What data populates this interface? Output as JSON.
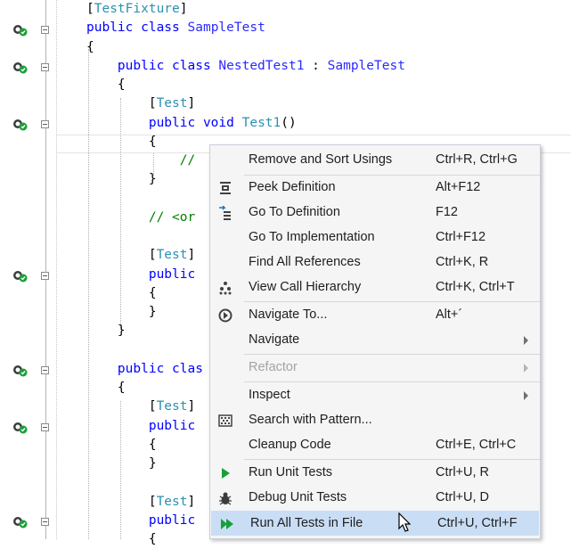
{
  "code_lines": [
    {
      "parts": [
        {
          "t": "[",
          "c": ""
        },
        {
          "t": "TestFixture",
          "c": "attr"
        },
        {
          "t": "]",
          "c": ""
        }
      ]
    },
    {
      "parts": [
        {
          "t": "public class ",
          "c": "kw"
        },
        {
          "t": "SampleTest",
          "c": "cls"
        }
      ]
    },
    {
      "parts": [
        {
          "t": "{",
          "c": ""
        }
      ]
    },
    {
      "parts": [
        {
          "t": "    public class ",
          "c": "kw"
        },
        {
          "t": "NestedTest1",
          "c": "cls"
        },
        {
          "t": " : ",
          "c": ""
        },
        {
          "t": "SampleTest",
          "c": "cls"
        }
      ]
    },
    {
      "parts": [
        {
          "t": "    {",
          "c": ""
        }
      ]
    },
    {
      "parts": [
        {
          "t": "        [",
          "c": ""
        },
        {
          "t": "Test",
          "c": "attr"
        },
        {
          "t": "]",
          "c": ""
        }
      ]
    },
    {
      "parts": [
        {
          "t": "        public void ",
          "c": "kw"
        },
        {
          "t": "Test1",
          "c": "ty"
        },
        {
          "t": "()",
          "c": ""
        }
      ]
    },
    {
      "parts": [
        {
          "t": "        {",
          "c": ""
        }
      ]
    },
    {
      "parts": [
        {
          "t": "            //",
          "c": "cm"
        }
      ]
    },
    {
      "parts": [
        {
          "t": "        }",
          "c": ""
        }
      ]
    },
    {
      "parts": [
        {
          "t": "",
          "c": ""
        }
      ]
    },
    {
      "parts": [
        {
          "t": "        // <or",
          "c": "cm"
        }
      ]
    },
    {
      "parts": [
        {
          "t": "",
          "c": ""
        }
      ]
    },
    {
      "parts": [
        {
          "t": "        [",
          "c": ""
        },
        {
          "t": "Test",
          "c": "attr"
        },
        {
          "t": "]",
          "c": ""
        }
      ]
    },
    {
      "parts": [
        {
          "t": "        public",
          "c": "kw"
        }
      ]
    },
    {
      "parts": [
        {
          "t": "        {",
          "c": ""
        }
      ]
    },
    {
      "parts": [
        {
          "t": "        }",
          "c": ""
        }
      ]
    },
    {
      "parts": [
        {
          "t": "    }",
          "c": ""
        }
      ]
    },
    {
      "parts": [
        {
          "t": "",
          "c": ""
        }
      ]
    },
    {
      "parts": [
        {
          "t": "    public clas",
          "c": "kw"
        }
      ]
    },
    {
      "parts": [
        {
          "t": "    {",
          "c": ""
        }
      ]
    },
    {
      "parts": [
        {
          "t": "        [",
          "c": ""
        },
        {
          "t": "Test",
          "c": "attr"
        },
        {
          "t": "]",
          "c": ""
        }
      ]
    },
    {
      "parts": [
        {
          "t": "        public",
          "c": "kw"
        }
      ]
    },
    {
      "parts": [
        {
          "t": "        {",
          "c": ""
        }
      ]
    },
    {
      "parts": [
        {
          "t": "        }",
          "c": ""
        }
      ]
    },
    {
      "parts": [
        {
          "t": "",
          "c": ""
        }
      ]
    },
    {
      "parts": [
        {
          "t": "        [",
          "c": ""
        },
        {
          "t": "Test",
          "c": "attr"
        },
        {
          "t": "]",
          "c": ""
        }
      ]
    },
    {
      "parts": [
        {
          "t": "        public",
          "c": "kw"
        }
      ]
    },
    {
      "parts": [
        {
          "t": "        {",
          "c": ""
        }
      ]
    }
  ],
  "context_menu": {
    "remove_sort_usings": {
      "label": "Remove and Sort Usings",
      "shortcut": "Ctrl+R, Ctrl+G"
    },
    "peek_definition": {
      "label": "Peek Definition",
      "shortcut": "Alt+F12",
      "icon": "peek-definition-icon"
    },
    "go_to_definition": {
      "label": "Go To Definition",
      "shortcut": "F12",
      "icon": "go-to-definition-icon"
    },
    "go_to_implementation": {
      "label": "Go To Implementation",
      "shortcut": "Ctrl+F12"
    },
    "find_all_references": {
      "label": "Find All References",
      "shortcut": "Ctrl+K, R"
    },
    "view_call_hierarchy": {
      "label": "View Call Hierarchy",
      "shortcut": "Ctrl+K, Ctrl+T",
      "icon": "call-hierarchy-icon"
    },
    "navigate_to": {
      "label": "Navigate To...",
      "shortcut": "Alt+´",
      "icon": "navigate-to-icon"
    },
    "navigate": {
      "label": "Navigate",
      "submenu": true
    },
    "refactor": {
      "label": "Refactor",
      "submenu": true,
      "disabled": true
    },
    "inspect": {
      "label": "Inspect",
      "submenu": true
    },
    "search_with_pattern": {
      "label": "Search with Pattern...",
      "icon": "search-pattern-icon"
    },
    "cleanup_code": {
      "label": "Cleanup Code",
      "shortcut": "Ctrl+E, Ctrl+C"
    },
    "run_unit_tests": {
      "label": "Run Unit Tests",
      "shortcut": "Ctrl+U, R",
      "icon": "run-tests-icon"
    },
    "debug_unit_tests": {
      "label": "Debug Unit Tests",
      "shortcut": "Ctrl+U, D",
      "icon": "debug-bug-icon"
    },
    "run_all_tests_in_file": {
      "label": "Run All Tests in File",
      "shortcut": "Ctrl+U, Ctrl+F",
      "icon": "run-all-tests-icon",
      "highlighted": true
    }
  },
  "colors": {
    "keyword": "#0000ff",
    "type": "#2b91af",
    "comment": "#008000",
    "menu_bg": "#f5f5f5",
    "menu_highlight": "#c9def5",
    "test_pass": "#1a9e3a"
  }
}
